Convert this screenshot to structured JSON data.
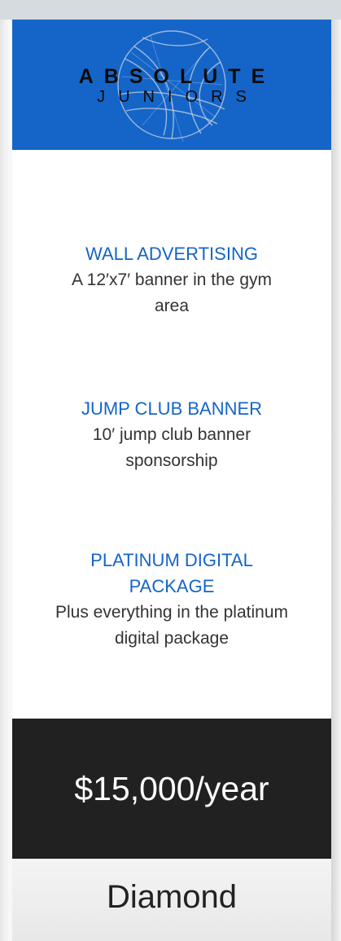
{
  "logo": {
    "line1": "ABSOLUTE",
    "line2": "JUNIORS",
    "emblem": "volleyball-icon"
  },
  "features": [
    {
      "title": "WALL ADVERTISING",
      "description": "A 12′x7′ banner in the gym area"
    },
    {
      "title": "JUMP CLUB BANNER",
      "description": "10′ jump club banner sponsorship"
    },
    {
      "title": "PLATINUM DIGITAL PACKAGE",
      "description": "Plus everything in the platinum digital package"
    }
  ],
  "price": "$15,000/year",
  "tier": "Diamond",
  "colors": {
    "brand_blue": "#1565c8",
    "price_bg": "#212121",
    "tier_bg": "#eeeeee"
  }
}
